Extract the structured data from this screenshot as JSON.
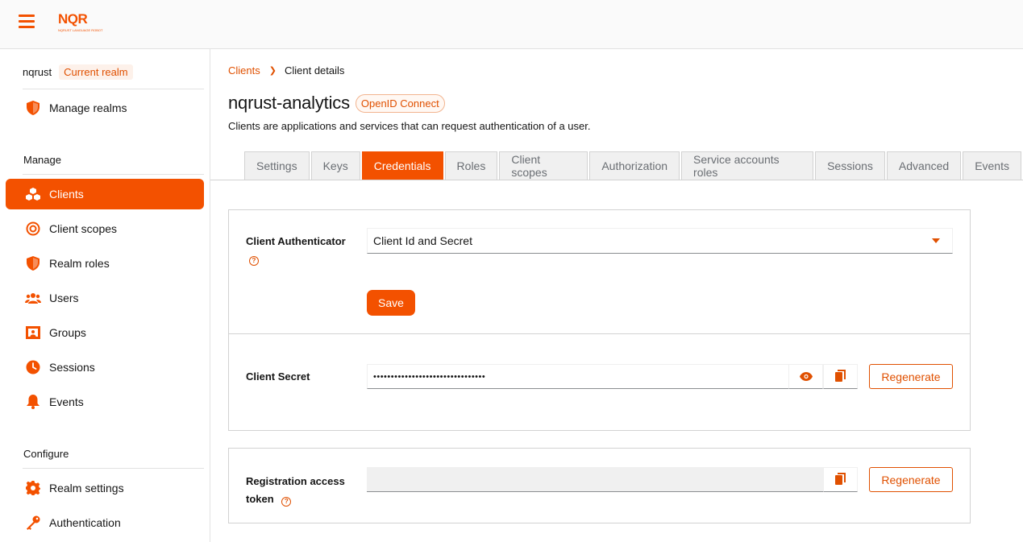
{
  "header": {
    "logo_text": "NQR",
    "logo_subtext": "NQRUST LANGUAGE ROBOT"
  },
  "sidebar": {
    "realm_name": "nqrust",
    "realm_badge": "Current realm",
    "manage_realms": "Manage realms",
    "manage_title": "Manage",
    "manage_items": [
      {
        "label": "Clients",
        "icon": "cubes-icon",
        "active": true
      },
      {
        "label": "Client scopes",
        "icon": "target-icon"
      },
      {
        "label": "Realm roles",
        "icon": "shield-icon"
      },
      {
        "label": "Users",
        "icon": "users-icon"
      },
      {
        "label": "Groups",
        "icon": "groups-icon"
      },
      {
        "label": "Sessions",
        "icon": "clock-icon"
      },
      {
        "label": "Events",
        "icon": "bell-icon"
      }
    ],
    "configure_title": "Configure",
    "configure_items": [
      {
        "label": "Realm settings",
        "icon": "gear-icon"
      },
      {
        "label": "Authentication",
        "icon": "key-icon"
      }
    ]
  },
  "breadcrumb": {
    "parent": "Clients",
    "current": "Client details"
  },
  "page": {
    "title": "nqrust-analytics",
    "protocol_badge": "OpenID Connect",
    "description": "Clients are applications and services that can request authentication of a user."
  },
  "tabs": [
    "Settings",
    "Keys",
    "Credentials",
    "Roles",
    "Client scopes",
    "Authorization",
    "Service accounts roles",
    "Sessions",
    "Advanced",
    "Events"
  ],
  "active_tab": "Credentials",
  "credentials": {
    "authenticator_label": "Client Authenticator",
    "authenticator_value": "Client Id and Secret",
    "save_label": "Save",
    "secret_label": "Client Secret",
    "secret_value": "••••••••••••••••••••••••••••••••",
    "regenerate_label": "Regenerate",
    "token_label_line1": "Registration access",
    "token_label_line2": "token",
    "token_regenerate_label": "Regenerate"
  },
  "colors": {
    "accent": "#f35100",
    "accent_text": "#e05000",
    "badge_bg": "#fdf1ea"
  }
}
